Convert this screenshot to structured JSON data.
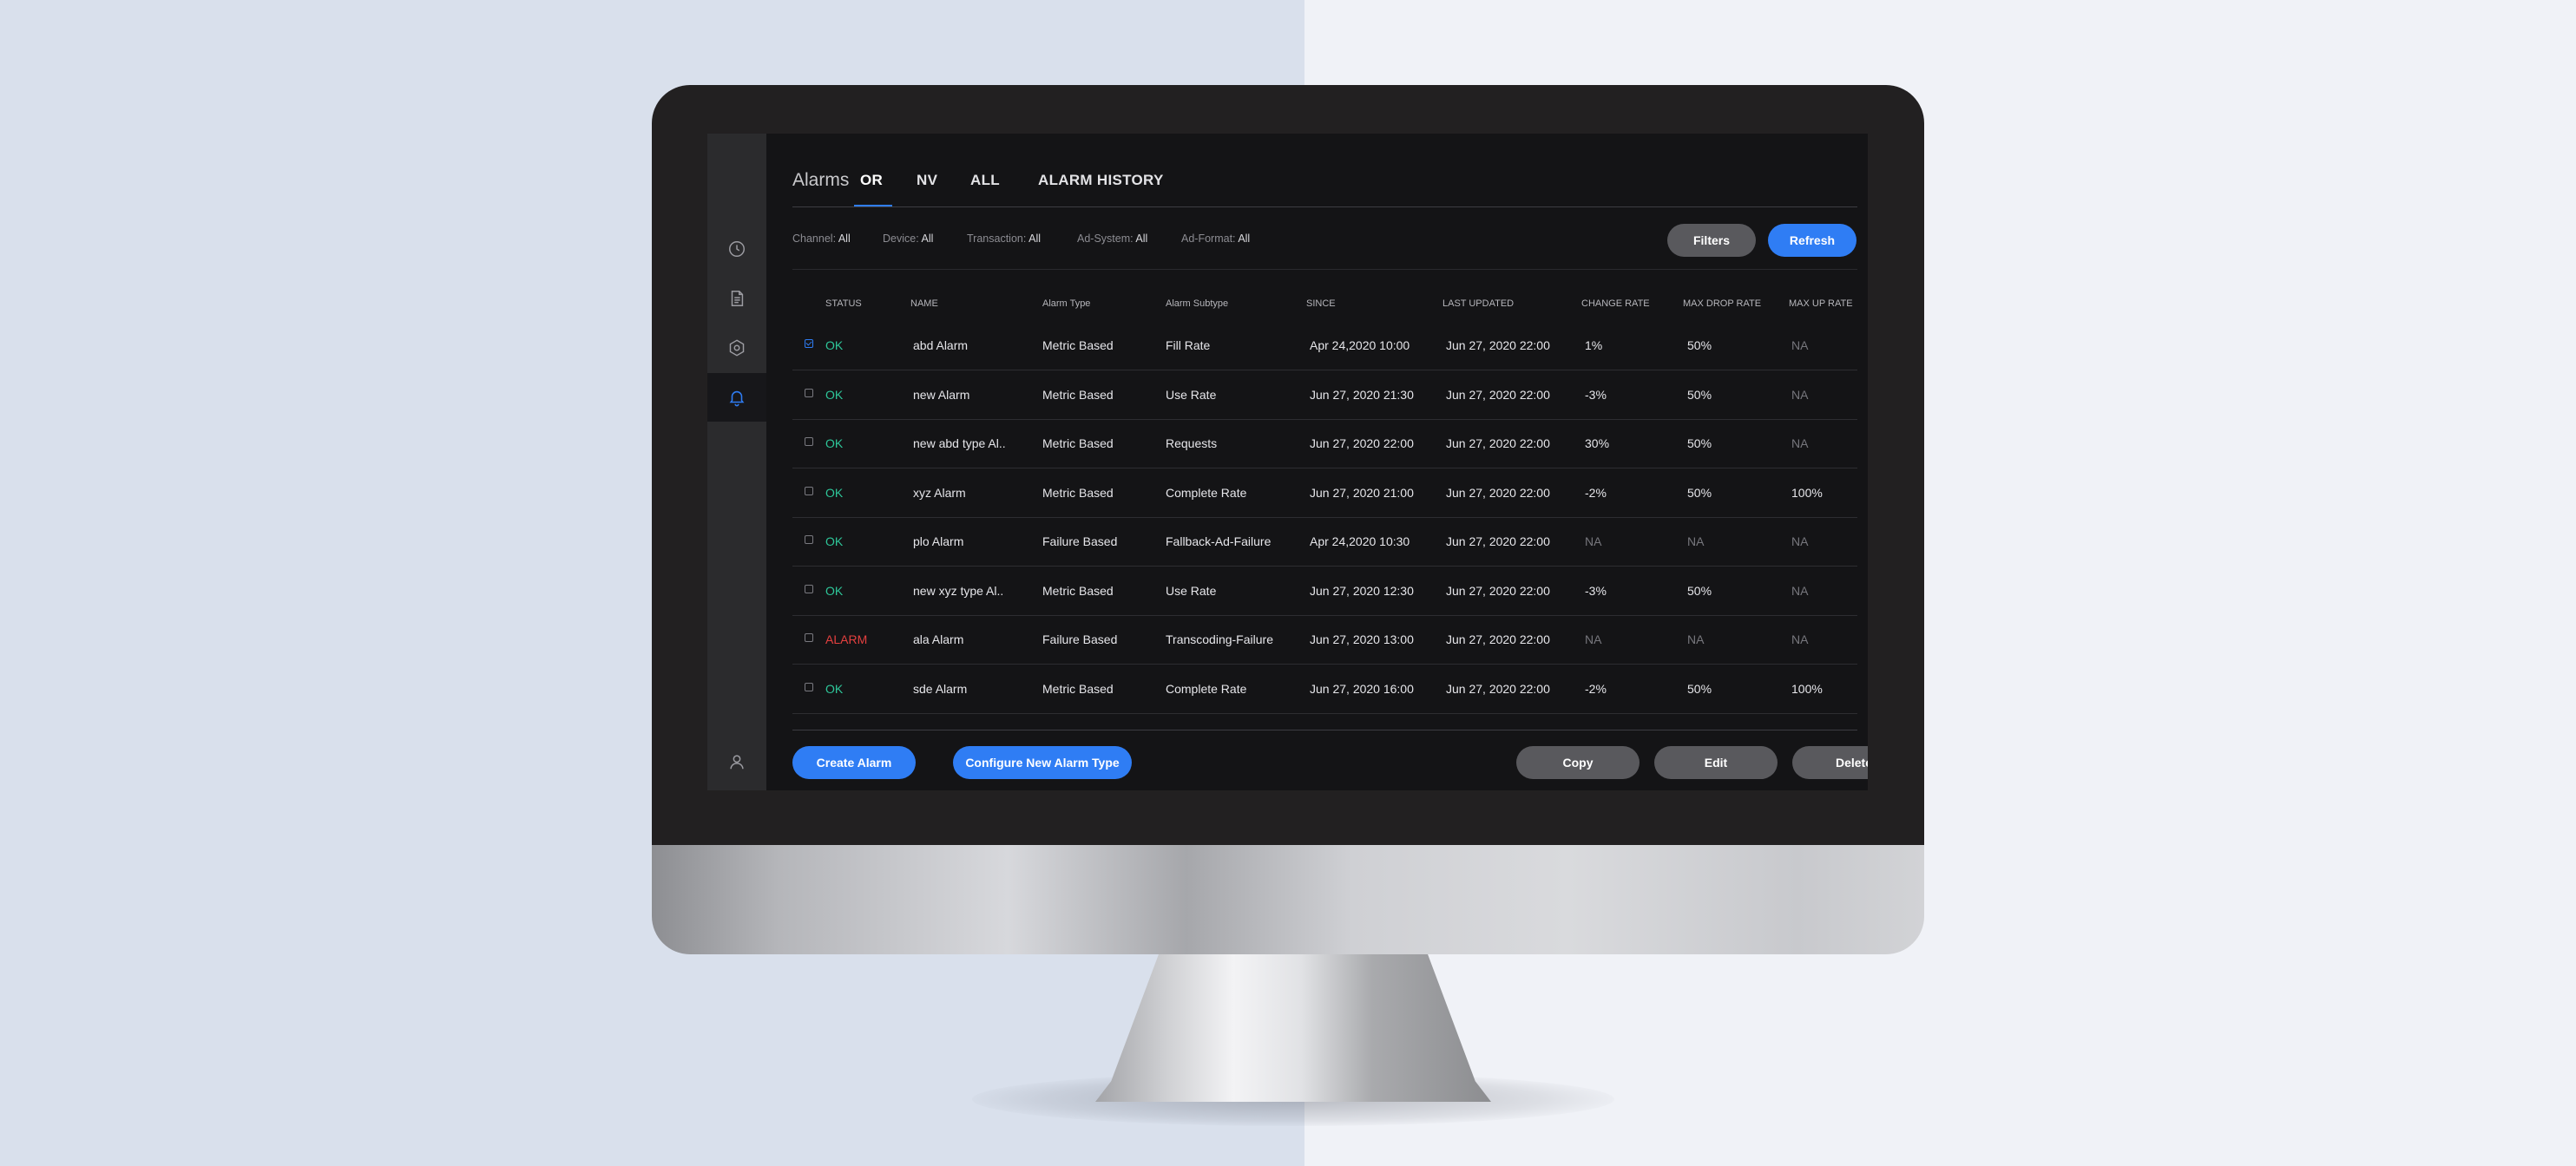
{
  "header": {
    "title": "Alarms",
    "tabs": [
      "OR",
      "NV",
      "ALL",
      "ALARM HISTORY"
    ],
    "active_tab": "OR"
  },
  "filters": [
    {
      "label": "Channel:",
      "value": "All"
    },
    {
      "label": "Device:",
      "value": "All"
    },
    {
      "label": "Transaction:",
      "value": "All"
    },
    {
      "label": "Ad-System:",
      "value": "All"
    },
    {
      "label": "Ad-Format:",
      "value": "All"
    }
  ],
  "toolbar": {
    "filters_label": "Filters",
    "refresh_label": "Refresh"
  },
  "table": {
    "columns": [
      "STATUS",
      "NAME",
      "Alarm Type",
      "Alarm Subtype",
      "SINCE",
      "LAST UPDATED",
      "CHANGE RATE",
      "MAX DROP RATE",
      "MAX UP RATE"
    ],
    "rows": [
      {
        "checked": true,
        "status": "OK",
        "name": "abd Alarm",
        "type": "Metric Based",
        "subtype": "Fill Rate",
        "since": "Apr 24,2020 10:00",
        "updated": "Jun 27, 2020 22:00",
        "change": "1%",
        "drop": "50%",
        "up": "NA"
      },
      {
        "checked": false,
        "status": "OK",
        "name": "new Alarm",
        "type": "Metric Based",
        "subtype": "Use Rate",
        "since": "Jun 27, 2020 21:30",
        "updated": "Jun 27, 2020 22:00",
        "change": "-3%",
        "drop": "50%",
        "up": "NA"
      },
      {
        "checked": false,
        "status": "OK",
        "name": "new abd type Al..",
        "type": "Metric Based",
        "subtype": "Requests",
        "since": "Jun 27, 2020 22:00",
        "updated": "Jun 27, 2020 22:00",
        "change": "30%",
        "drop": "50%",
        "up": "NA"
      },
      {
        "checked": false,
        "status": "OK",
        "name": "xyz Alarm",
        "type": "Metric Based",
        "subtype": "Complete Rate",
        "since": "Jun 27, 2020 21:00",
        "updated": "Jun 27, 2020 22:00",
        "change": "-2%",
        "drop": "50%",
        "up": "100%"
      },
      {
        "checked": false,
        "status": "OK",
        "name": "plo Alarm",
        "type": "Failure Based",
        "subtype": "Fallback-Ad-Failure",
        "since": "Apr 24,2020 10:30",
        "updated": "Jun 27, 2020 22:00",
        "change": "NA",
        "drop": "NA",
        "up": "NA"
      },
      {
        "checked": false,
        "status": "OK",
        "name": "new xyz type Al..",
        "type": "Metric Based",
        "subtype": "Use Rate",
        "since": "Jun 27, 2020 12:30",
        "updated": "Jun 27, 2020 22:00",
        "change": "-3%",
        "drop": "50%",
        "up": "NA"
      },
      {
        "checked": false,
        "status": "ALARM",
        "name": "ala Alarm",
        "type": "Failure Based",
        "subtype": "Transcoding-Failure",
        "since": "Jun 27, 2020 13:00",
        "updated": "Jun 27, 2020 22:00",
        "change": "NA",
        "drop": "NA",
        "up": "NA"
      },
      {
        "checked": false,
        "status": "OK",
        "name": "sde Alarm",
        "type": "Metric Based",
        "subtype": "Complete Rate",
        "since": "Jun 27, 2020 16:00",
        "updated": "Jun 27, 2020 22:00",
        "change": "-2%",
        "drop": "50%",
        "up": "100%"
      }
    ]
  },
  "footer": {
    "create_label": "Create Alarm",
    "configure_label": "Configure New Alarm Type",
    "copy_label": "Copy",
    "edit_label": "Edit",
    "delete_label": "Delete"
  },
  "sidebar": {
    "icons": [
      "clock-icon",
      "document-icon",
      "settings-hex-icon",
      "bell-icon",
      "user-icon"
    ],
    "active": "bell-icon"
  },
  "colors": {
    "accent": "#2f7df4",
    "ok": "#2ec79a",
    "alarm": "#e5403f",
    "screen_bg": "#141416",
    "sidebar_bg": "#2b2b2d"
  }
}
